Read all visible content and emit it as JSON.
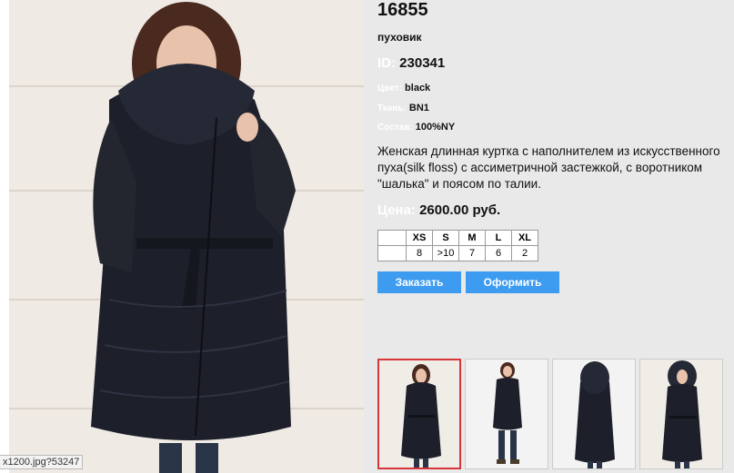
{
  "product": {
    "title": "16855",
    "type": "пуховик",
    "id_label": "ID:",
    "id_value": "230341",
    "attributes": [
      {
        "label": "Цвет:",
        "value": "black"
      },
      {
        "label": "Ткань:",
        "value": "BN1"
      },
      {
        "label": "Состав:",
        "value": "100%NY"
      }
    ],
    "description": "Женская длинная  куртка  с наполнителем из искусственного пуха(silk floss)  с ассиметричной застежкой, с воротником \"шалька\" и поясом по талии.",
    "price_label": "Цена:",
    "price_value": "2600.00 руб."
  },
  "sizes": {
    "headers": [
      "XS",
      "S",
      "M",
      "L",
      "XL"
    ],
    "values": [
      "8",
      ">10",
      "7",
      "6",
      "2"
    ]
  },
  "buttons": {
    "order": "Заказать",
    "checkout": "Оформить"
  },
  "status_url": "x1200.jpg?53247",
  "colors": {
    "button": "#3d9bf0",
    "active_thumb_border": "#d9363a",
    "panel_bg": "#e9e9e9",
    "label_light": "#ffffff"
  }
}
